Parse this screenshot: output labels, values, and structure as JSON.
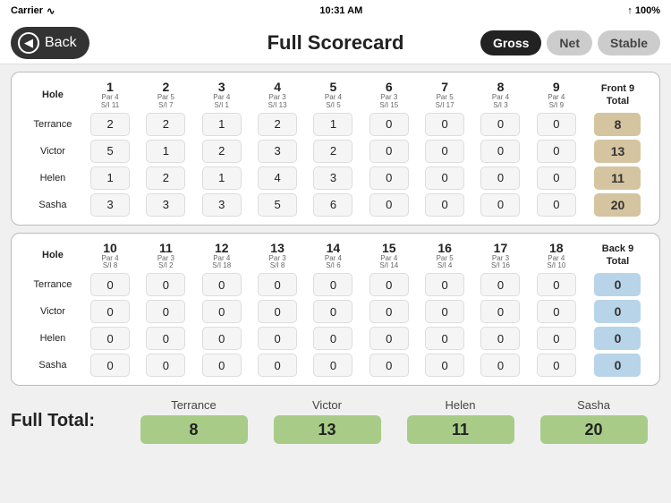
{
  "statusBar": {
    "carrier": "Carrier",
    "time": "10:31 AM",
    "signal": "100%"
  },
  "header": {
    "backLabel": "Back",
    "title": "Full Scorecard",
    "scoreTypes": [
      "Gross",
      "Net",
      "Stable"
    ],
    "activeType": "Gross"
  },
  "frontNine": {
    "sectionLabel": "Front 9 Total",
    "holes": [
      {
        "num": "1",
        "par": "4",
        "si": "11"
      },
      {
        "num": "2",
        "par": "5",
        "si": "7"
      },
      {
        "num": "3",
        "par": "4",
        "si": "1"
      },
      {
        "num": "4",
        "par": "3",
        "si": "13"
      },
      {
        "num": "5",
        "par": "4",
        "si": "5"
      },
      {
        "num": "6",
        "par": "3",
        "si": "15"
      },
      {
        "num": "7",
        "par": "5",
        "si": "17"
      },
      {
        "num": "8",
        "par": "4",
        "si": "3"
      },
      {
        "num": "9",
        "par": "4",
        "si": "9"
      }
    ],
    "players": [
      {
        "name": "Terrance",
        "scores": [
          2,
          2,
          1,
          2,
          1,
          0,
          0,
          0,
          0
        ],
        "total": 8
      },
      {
        "name": "Victor",
        "scores": [
          5,
          1,
          2,
          3,
          2,
          0,
          0,
          0,
          0
        ],
        "total": 13
      },
      {
        "name": "Helen",
        "scores": [
          1,
          2,
          1,
          4,
          3,
          0,
          0,
          0,
          0
        ],
        "total": 11
      },
      {
        "name": "Sasha",
        "scores": [
          3,
          3,
          3,
          5,
          6,
          0,
          0,
          0,
          0
        ],
        "total": 20
      }
    ]
  },
  "backNine": {
    "sectionLabel": "Back 9 Total",
    "holes": [
      {
        "num": "10",
        "par": "4",
        "si": "8"
      },
      {
        "num": "11",
        "par": "3",
        "si": "2"
      },
      {
        "num": "12",
        "par": "4",
        "si": "18"
      },
      {
        "num": "13",
        "par": "3",
        "si": "8"
      },
      {
        "num": "14",
        "par": "4",
        "si": "6"
      },
      {
        "num": "15",
        "par": "4",
        "si": "14"
      },
      {
        "num": "16",
        "par": "5",
        "si": "4"
      },
      {
        "num": "17",
        "par": "3",
        "si": "16"
      },
      {
        "num": "18",
        "par": "4",
        "si": "10"
      }
    ],
    "players": [
      {
        "name": "Terrance",
        "scores": [
          0,
          0,
          0,
          0,
          0,
          0,
          0,
          0,
          0
        ],
        "total": 0
      },
      {
        "name": "Victor",
        "scores": [
          0,
          0,
          0,
          0,
          0,
          0,
          0,
          0,
          0
        ],
        "total": 0
      },
      {
        "name": "Helen",
        "scores": [
          0,
          0,
          0,
          0,
          0,
          0,
          0,
          0,
          0
        ],
        "total": 0
      },
      {
        "name": "Sasha",
        "scores": [
          0,
          0,
          0,
          0,
          0,
          0,
          0,
          0,
          0
        ],
        "total": 0
      }
    ]
  },
  "fullTotals": {
    "label": "Full Total:",
    "players": [
      {
        "name": "Terrance",
        "total": 8
      },
      {
        "name": "Victor",
        "total": 13
      },
      {
        "name": "Helen",
        "total": 11
      },
      {
        "name": "Sasha",
        "total": 20
      }
    ]
  }
}
